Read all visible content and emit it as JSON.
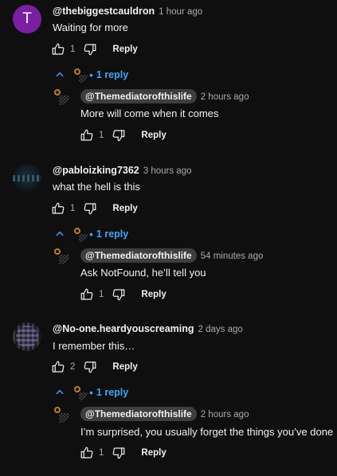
{
  "threads": [
    {
      "author": "@thebiggestcauldron",
      "time": "1 hour ago",
      "avatar_letter": "T",
      "text": "Waiting for more",
      "likes": "1",
      "reply_label": "Reply",
      "replies_toggle": "1 reply",
      "reply": {
        "author": "@Themediatorofthislife",
        "time": "2 hours ago",
        "text": "More will come when it comes",
        "likes": "1",
        "reply_label": "Reply"
      }
    },
    {
      "author": "@pabloizking7362",
      "time": "3 hours ago",
      "text": "what the hell is this",
      "likes": "1",
      "reply_label": "Reply",
      "replies_toggle": "1 reply",
      "reply": {
        "author": "@Themediatorofthislife",
        "time": "54 minutes ago",
        "text": "Ask NotFound, he’ll tell you",
        "likes": "1",
        "reply_label": "Reply"
      }
    },
    {
      "author": "@No-one.heardyouscreaming",
      "time": "2 days ago",
      "text": "I remember this…",
      "likes": "2",
      "reply_label": "Reply",
      "replies_toggle": "1 reply",
      "reply": {
        "author": "@Themediatorofthislife",
        "time": "2 hours ago",
        "text": "I’m surprised, you usually forget the things you’ve done",
        "likes": "1",
        "reply_label": "Reply"
      }
    }
  ],
  "colors": {
    "background": "#0f0f0f",
    "text": "#f1f1f1",
    "muted": "#aaaaaa",
    "link_blue": "#3ea6ff",
    "chip": "#3e3e3e",
    "avatar_purple": "#7b1fa2"
  },
  "icons": [
    "like-icon",
    "dislike-icon",
    "chevron-up-icon"
  ]
}
